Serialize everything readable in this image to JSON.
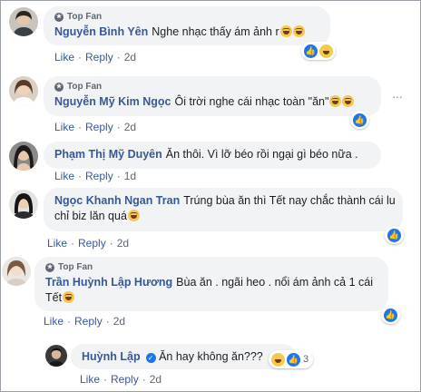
{
  "colors": {
    "author": "#385898",
    "link": "#385898",
    "meta": "#606770",
    "bubble": "#f2f3f5",
    "like": "#1877f2"
  },
  "labels": {
    "like": "Like",
    "reply": "Reply",
    "top_fan": "Top Fan",
    "dot": "·"
  },
  "comments": [
    {
      "author": "Nguyễn Bình Yên",
      "badge": true,
      "text": "Nghe nhạc thấy ám ảnh r",
      "reactions": [
        "like",
        "haha"
      ],
      "count": "",
      "time": "2d",
      "avatar": "female-dark-hair"
    },
    {
      "author": "Nguyễn Mỹ Kim Ngọc",
      "badge": true,
      "text": "Ôi trời nghe cái nhạc toàn \"ăn\"",
      "reactions": [
        "like"
      ],
      "count": "",
      "time": "2d",
      "avatar": "female-brown-hair"
    },
    {
      "author": "Phạm Thị Mỹ Duyên",
      "badge": false,
      "text": "Ăn thôi. Vì lỡ béo rồi ngại gì béo nữa .",
      "reactions": [],
      "count": "",
      "time": "1d",
      "avatar": "female-long-hair"
    },
    {
      "author": "Ngọc Khanh Ngan Tran",
      "badge": false,
      "text_line1": "Trúng bùa ăn thì Tết nay chắc thành cái lu",
      "text_line2": "chỉ biz lăn quá",
      "reactions": [
        "like"
      ],
      "count": "",
      "time": "2d",
      "avatar": "female-dark-hair"
    },
    {
      "author": "Trần Huỳnh Lập Hương",
      "badge": true,
      "text_line1": "Bùa ăn . ngãi heo . nổi ám ảnh cả 1 cái",
      "text_line2": "Tết",
      "reactions": [
        "like"
      ],
      "count": "",
      "time": "2d",
      "avatar": "female-light"
    },
    {
      "author": "Huỳnh Lập",
      "badge": false,
      "verified": true,
      "text": "Ăn hay không ăn???",
      "reactions": [
        "haha",
        "like"
      ],
      "count": "3",
      "time": "2d",
      "avatar": "male-dark"
    }
  ]
}
